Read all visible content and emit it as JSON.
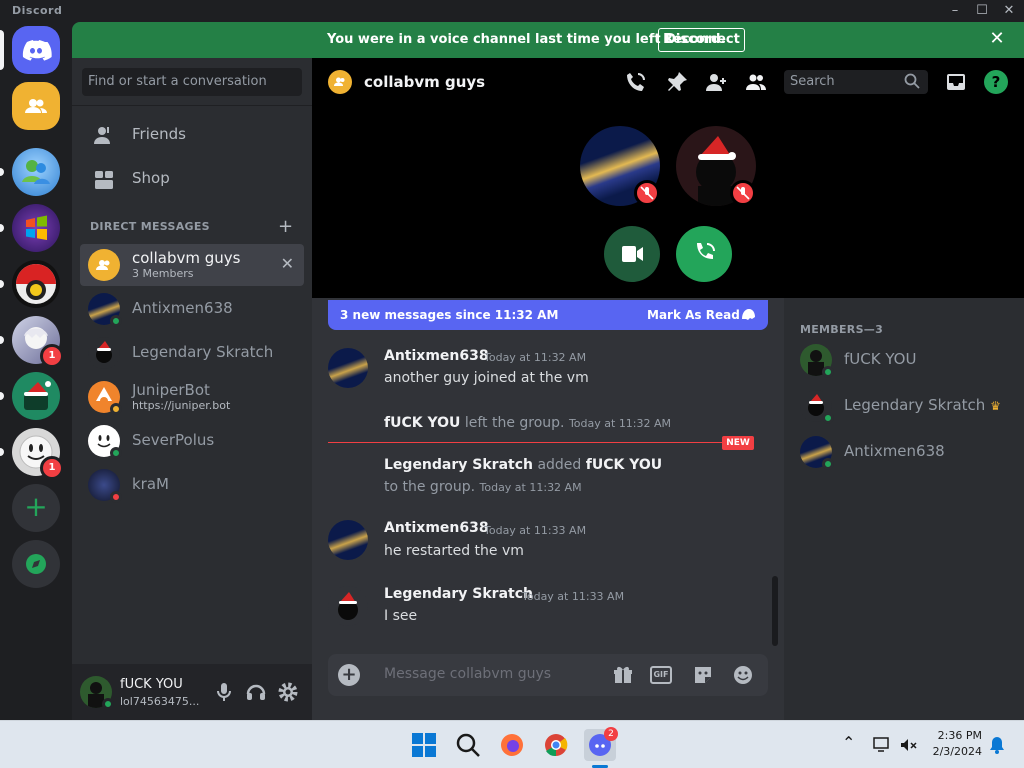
{
  "window": {
    "app_title": "Discord",
    "minimize": "–",
    "maximize": "☐",
    "close": "✕"
  },
  "notice": {
    "text": "You were in a voice channel last time you left Discord.",
    "button": "Reconnect",
    "close": "✕"
  },
  "sidebar": {
    "search_placeholder": "Find or start a conversation",
    "nav": [
      {
        "label": "Friends"
      },
      {
        "label": "Shop"
      }
    ],
    "dm_header": "DIRECT MESSAGES",
    "dm_add": "+",
    "dms": [
      {
        "name": "collabvm guys",
        "sub": "3 Members",
        "close": "✕"
      },
      {
        "name": "Antixmen638"
      },
      {
        "name": "Legendary Skratch"
      },
      {
        "name": "JuniperBot",
        "sub": "https://juniper.bot"
      },
      {
        "name": "SeverPolus"
      },
      {
        "name": "kraM"
      }
    ]
  },
  "servers": {
    "badges": [
      "1",
      "1"
    ],
    "add": "+"
  },
  "user": {
    "name": "fUCK YOU",
    "tag": "lol74563475..."
  },
  "channel": {
    "name": "collabvm guys",
    "search_placeholder": "Search"
  },
  "chat": {
    "new_messages": "3 new messages since 11:32 AM",
    "mark_as_read": "Mark As Read",
    "new_tag": "NEW",
    "messages": [
      {
        "author": "Antixmen638",
        "time": "Today at 11:32 AM",
        "text": "another guy joined at the vm"
      },
      {
        "sys_user": "fUCK YOU",
        "sys_text": "left the group.",
        "time": "Today at 11:32 AM"
      },
      {
        "sys_user": "Legendary Skratch",
        "sys_mid": "added",
        "sys_target": "fUCK YOU",
        "sys_text": "to the group.",
        "time": "Today at 11:32 AM"
      },
      {
        "author": "Antixmen638",
        "time": "Today at 11:33 AM",
        "text": "he restarted the vm"
      },
      {
        "author": "Legendary Skratch",
        "time": "Today at 11:33 AM",
        "text": "I see"
      }
    ],
    "composer_placeholder": "Message collabvm guys"
  },
  "members": {
    "header": "MEMBERS—3",
    "list": [
      {
        "name": "fUCK YOU"
      },
      {
        "name": "Legendary Skratch",
        "crown": "♛"
      },
      {
        "name": "Antixmen638"
      }
    ]
  },
  "taskbar": {
    "time": "2:36 PM",
    "date": "2/3/2024",
    "discord_badge": "2",
    "tray_chevron": "⌃"
  },
  "colors": {
    "accent": "#5865f2",
    "green": "#23a55a",
    "red": "#f23f43",
    "notice": "#248046"
  }
}
